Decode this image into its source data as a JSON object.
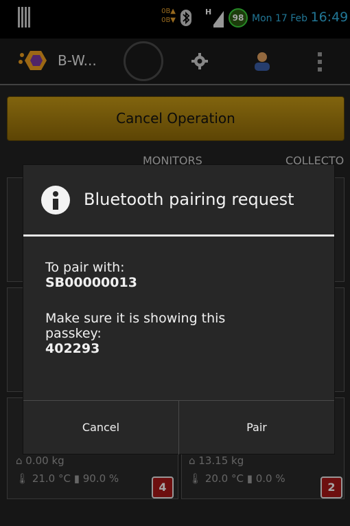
{
  "status": {
    "net_up": "0B▲",
    "net_down": "0B▼",
    "network_type": "H",
    "battery": "98",
    "date": "Mon 17 Feb",
    "time": "16:49"
  },
  "actionbar": {
    "title": "B-W...",
    "icons": [
      "app-logo-icon",
      "spinner",
      "gear-icon",
      "avatar-icon",
      "overflow-icon"
    ]
  },
  "main": {
    "cancel_label": "Cancel Operation",
    "tabs": [
      "MONITORS",
      "COLLECTO"
    ]
  },
  "cards": [
    {
      "weight": "0.00 kg",
      "temp": "21.0 °C",
      "battery": "90.0 %",
      "badge": "4"
    },
    {
      "weight": "13.15 kg",
      "temp": "20.0 °C",
      "battery": "0.0 %",
      "badge": "2"
    }
  ],
  "dialog": {
    "title": "Bluetooth pairing request",
    "pair_with_label": "To pair with:",
    "device": "SB00000013",
    "passkey_prompt_line1": "Make sure it is showing this",
    "passkey_prompt_line2": "passkey:",
    "passkey": "402293",
    "cancel_label": "Cancel",
    "pair_label": "Pair"
  },
  "colors": {
    "accent_blue": "#33b5e5",
    "cancel_op_bg": "#b5880f",
    "badge_red": "#a81818",
    "battery_green": "#3bd33b"
  }
}
